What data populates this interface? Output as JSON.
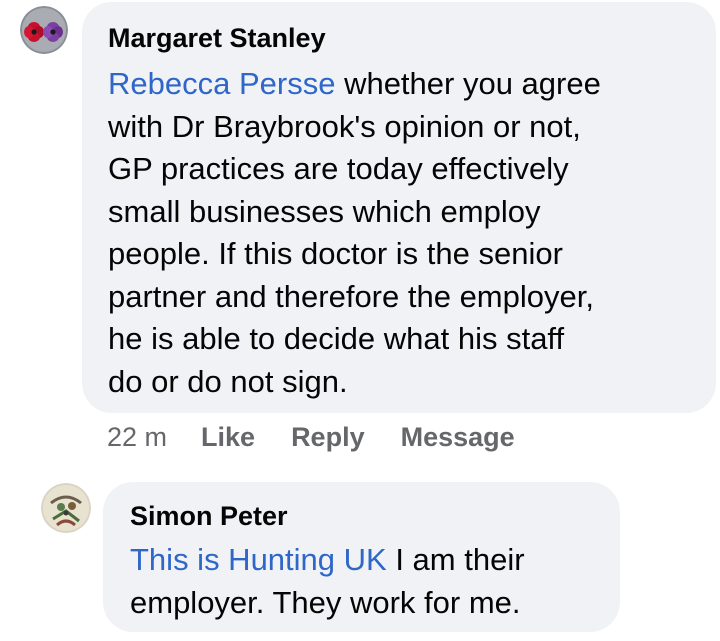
{
  "comments": [
    {
      "author": "Margaret Stanley",
      "mention": "Rebecca Persse",
      "text_lines": [
        " whether you agree",
        "with Dr Braybrook's opinion or not,",
        "GP practices are today effectively",
        "small businesses which employ",
        "people. If this doctor is the senior",
        "partner and therefore the employer,",
        "he is able to decide what his staff",
        "do or do not sign."
      ],
      "timestamp": "22 m",
      "actions": {
        "like": "Like",
        "reply": "Reply",
        "message": "Message"
      },
      "avatar_icon": "poppy-avatar"
    },
    {
      "author": "Simon Peter",
      "mention": "This is Hunting UK",
      "text_lines": [
        " I am their",
        "employer. They work for me."
      ],
      "avatar_icon": "illustration-avatar"
    }
  ],
  "colors": {
    "bubble": "#f0f2f5",
    "mention": "#2f67c9",
    "meta": "#65676b",
    "text": "#050505"
  }
}
